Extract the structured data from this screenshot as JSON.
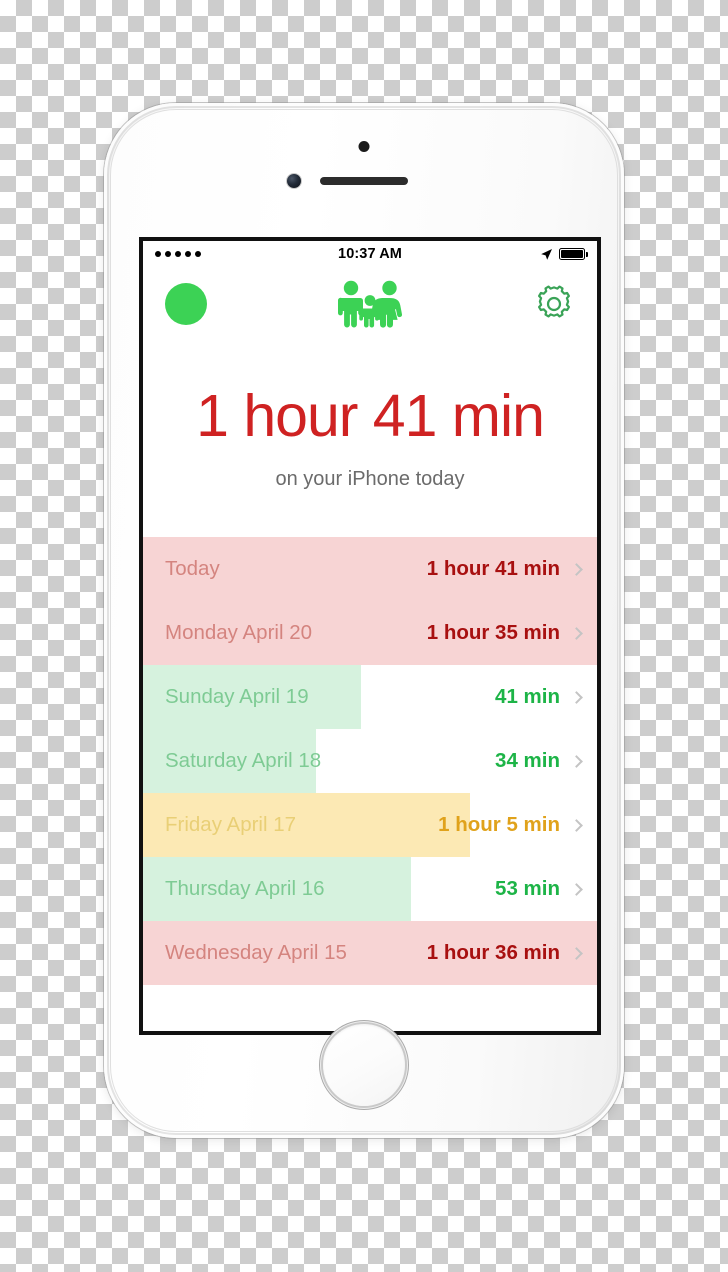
{
  "statusbar": {
    "signal_dots": 5,
    "time": "10:37 AM",
    "location_icon": "location-arrow-icon",
    "battery_icon": "battery-full-icon"
  },
  "navbar": {
    "left_icon": "green-circle-icon",
    "center_icon": "family-icon",
    "right_icon": "gear-icon"
  },
  "summary": {
    "headline": "1 hour 41 min",
    "subline": "on your iPhone today",
    "headline_color": "#cf2222"
  },
  "colors": {
    "red_bar": "#f7d4d4",
    "red_text_day": "#d4847f",
    "red_text_value": "#a81010",
    "green_bar": "#d6f2de",
    "green_text_day": "#7ecb94",
    "green_text_value": "#1db447",
    "yellow_bar": "#fce9b4",
    "yellow_text_day": "#e9cf76",
    "yellow_text_value": "#e0a21b",
    "chevron": "#c4c4c4",
    "accent_green": "#3cd255"
  },
  "list": {
    "rows": [
      {
        "day": "Today",
        "value": "1 hour 41 min",
        "level": "red",
        "bar_pct": 100
      },
      {
        "day": "Monday April 20",
        "value": "1 hour 35 min",
        "level": "red",
        "bar_pct": 100
      },
      {
        "day": "Sunday April 19",
        "value": "41 min",
        "level": "green",
        "bar_pct": 48
      },
      {
        "day": "Saturday April 18",
        "value": "34 min",
        "level": "green",
        "bar_pct": 38
      },
      {
        "day": "Friday April 17",
        "value": "1 hour 5 min",
        "level": "yellow",
        "bar_pct": 72
      },
      {
        "day": "Thursday April 16",
        "value": "53 min",
        "level": "green",
        "bar_pct": 59
      },
      {
        "day": "Wednesday April 15",
        "value": "1 hour 36 min",
        "level": "red",
        "bar_pct": 100
      }
    ]
  }
}
